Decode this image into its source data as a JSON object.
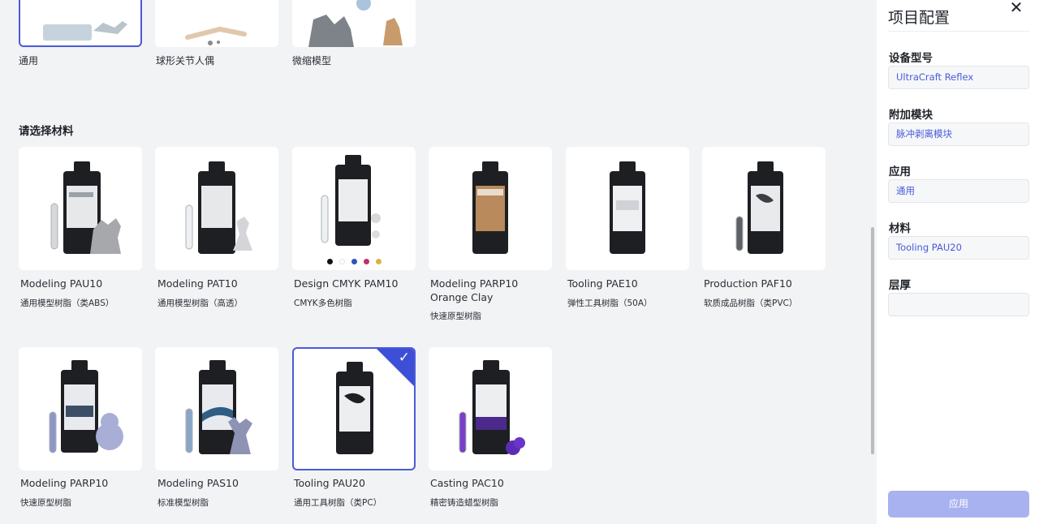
{
  "usage_row": [
    {
      "label": "通用"
    },
    {
      "label": "球形关节人偶"
    },
    {
      "label": "微缩模型"
    }
  ],
  "section_title": "请选择材料",
  "materials": [
    {
      "name": "Modeling PAU10",
      "sub": "通用模型树脂（类ABS）"
    },
    {
      "name": "Modeling PAT10",
      "sub": "通用模型树脂（高透）"
    },
    {
      "name": "Design CMYK PAM10",
      "sub": "CMYK多色树脂"
    },
    {
      "name": "Modeling PARP10 Orange Clay",
      "sub": "快速原型树脂"
    },
    {
      "name": "Tooling PAE10",
      "sub": "弹性工具树脂（50A）"
    },
    {
      "name": "Production PAF10",
      "sub": "软质成品树脂（类PVC）"
    },
    {
      "name": "Modeling PARP10",
      "sub": "快速原型树脂"
    },
    {
      "name": "Modeling PAS10",
      "sub": "标准模型树脂"
    },
    {
      "name": "Tooling PAU20",
      "sub": "通用工具树脂（类PC）",
      "selected": true
    },
    {
      "name": "Casting PAC10",
      "sub": "精密铸造蜡型树脂"
    }
  ],
  "cmyk_dots": [
    "#111111",
    "#ffffff",
    "#2f56b5",
    "#c0306a",
    "#d8b445"
  ],
  "panel": {
    "title": "项目配置",
    "device_label": "设备型号",
    "device_value": "UltraCraft Reflex",
    "module_label": "附加模块",
    "module_value": "脉冲剥离模块",
    "application_label": "应用",
    "application_value": "通用",
    "material_label": "材料",
    "material_value": "Tooling PAU20",
    "layer_label": "层厚",
    "layer_value": "",
    "apply_button": "应用"
  },
  "colors": {
    "accent": "#4a5bd8",
    "apply_disabled": "#a9b2f0"
  }
}
